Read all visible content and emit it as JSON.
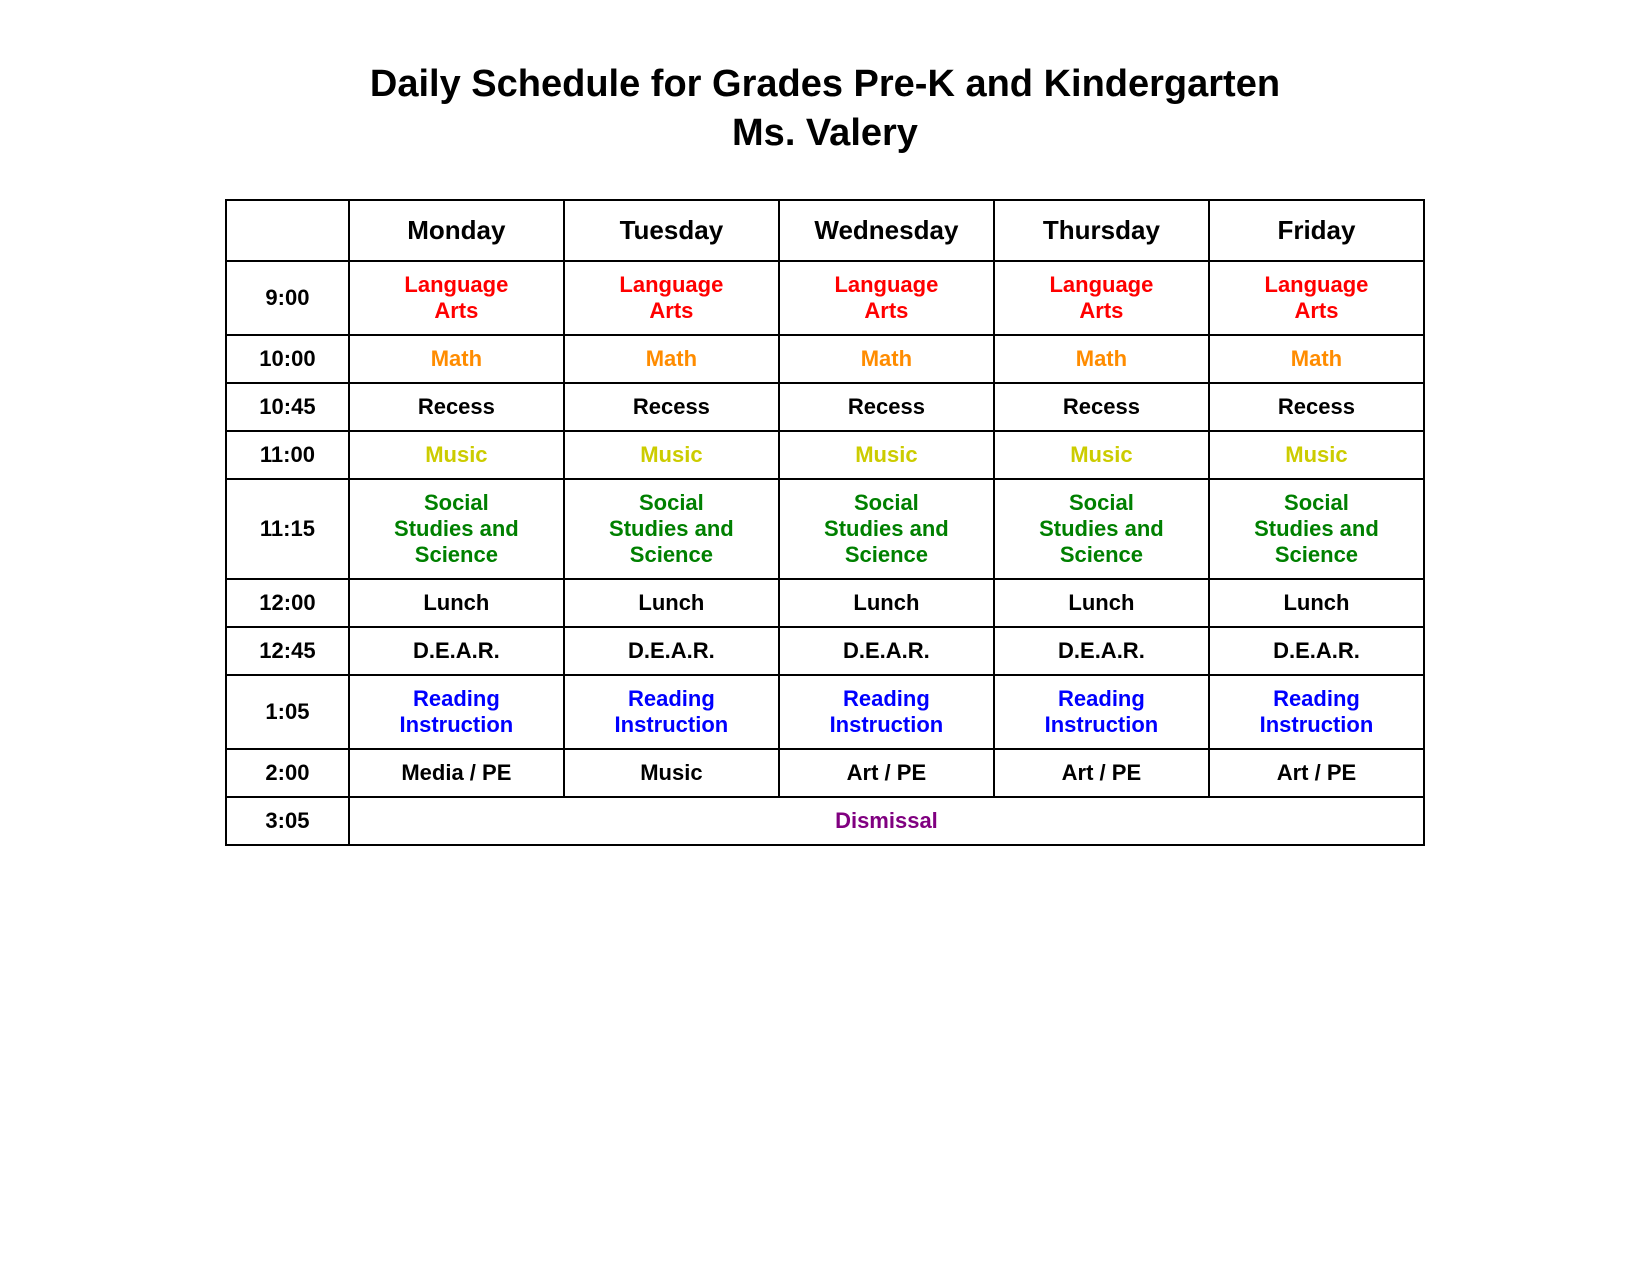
{
  "title": {
    "line1": "Daily Schedule for Grades Pre-K and Kindergarten",
    "line2": "Ms. Valery"
  },
  "headers": {
    "time": "",
    "monday": "Monday",
    "tuesday": "Tuesday",
    "wednesday": "Wednesday",
    "thursday": "Thursday",
    "friday": "Friday"
  },
  "rows": [
    {
      "time": "9:00",
      "cells": [
        "Language Arts",
        "Language Arts",
        "Language Arts",
        "Language Arts",
        "Language Arts"
      ],
      "colorClass": "color-red"
    },
    {
      "time": "10:00",
      "cells": [
        "Math",
        "Math",
        "Math",
        "Math",
        "Math"
      ],
      "colorClass": "color-orange"
    },
    {
      "time": "10:45",
      "cells": [
        "Recess",
        "Recess",
        "Recess",
        "Recess",
        "Recess"
      ],
      "colorClass": "color-black"
    },
    {
      "time": "11:00",
      "cells": [
        "Music",
        "Music",
        "Music",
        "Music",
        "Music"
      ],
      "colorClass": "color-yellow"
    },
    {
      "time": "11:15",
      "cells": [
        "Social Studies and Science",
        "Social Studies and Science",
        "Social Studies and Science",
        "Social Studies and Science",
        "Social Studies and Science"
      ],
      "colorClass": "color-green"
    },
    {
      "time": "12:00",
      "cells": [
        "Lunch",
        "Lunch",
        "Lunch",
        "Lunch",
        "Lunch"
      ],
      "colorClass": "color-black"
    },
    {
      "time": "12:45",
      "cells": [
        "D.E.A.R.",
        "D.E.A.R.",
        "D.E.A.R.",
        "D.E.A.R.",
        "D.E.A.R."
      ],
      "colorClass": "color-black"
    },
    {
      "time": "1:05",
      "cells": [
        "Reading Instruction",
        "Reading Instruction",
        "Reading Instruction",
        "Reading Instruction",
        "Reading Instruction"
      ],
      "colorClass": "color-blue"
    },
    {
      "time": "2:00",
      "cells": [
        "Media / PE",
        "Music",
        "Art / PE",
        "Art / PE",
        "Art / PE"
      ],
      "colorClass": "color-black"
    },
    {
      "time": "3:05",
      "cells": [
        "Dismissal"
      ],
      "colorClass": "color-purple",
      "colspan": 5
    }
  ]
}
